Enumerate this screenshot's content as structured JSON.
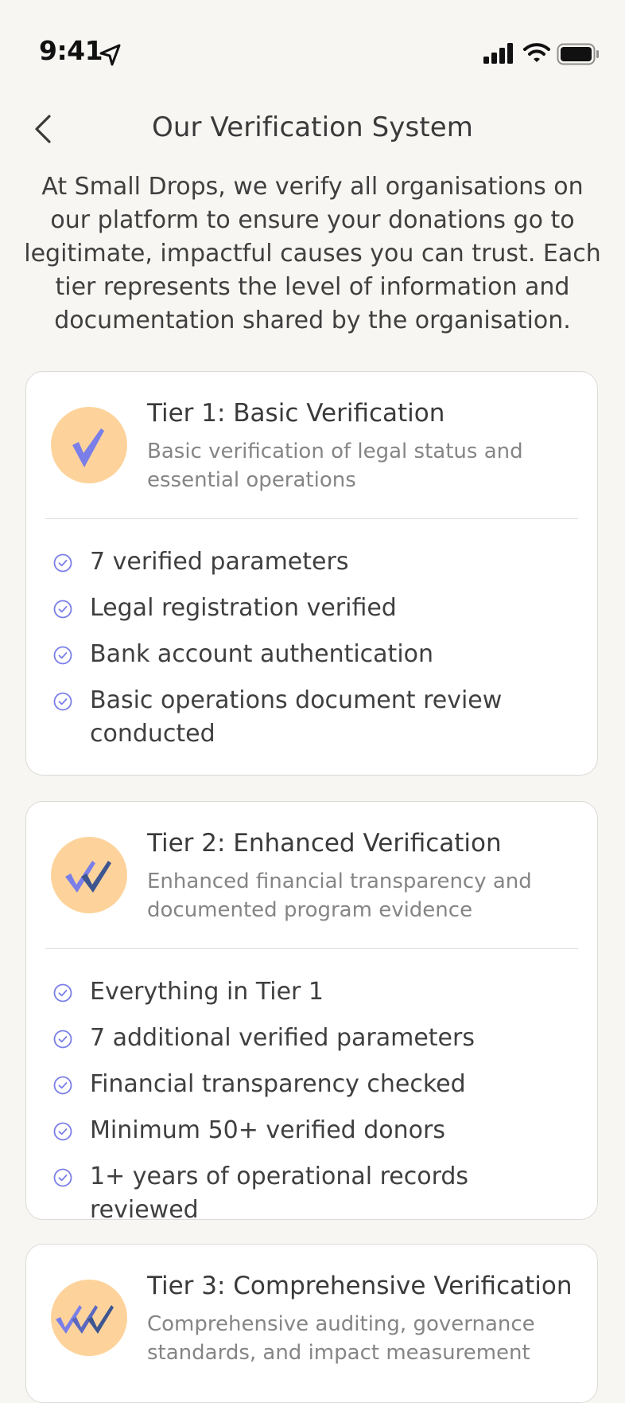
{
  "status_bar": {
    "time": "9:41",
    "icons": [
      "location-arrow-icon",
      "cellular-signal-icon",
      "wifi-icon",
      "battery-icon"
    ]
  },
  "header": {
    "back_icon": "chevron-left-icon",
    "title": "Our Verification System"
  },
  "intro": "At Small Drops, we verify all organisations on our platform to ensure your donations go to legitimate, impactful causes you can trust. Each tier represents the level of information and documentation shared by the organisation.",
  "colors": {
    "background": "#f7f6f3",
    "card": "#ffffff",
    "badge": "#fdd39b",
    "check_accent": "#7a7ee8",
    "check_dark": "#3d5590"
  },
  "tiers": [
    {
      "title": "Tier 1: Basic Verification",
      "description": "Basic verification of legal status and essential operations",
      "badge_icon": "single-check-icon",
      "features": [
        "7 verified parameters",
        "Legal registration verified",
        "Bank account authentication",
        "Basic operations document review conducted"
      ]
    },
    {
      "title": "Tier 2: Enhanced Verification",
      "description": "Enhanced financial transparency and documented program evidence",
      "badge_icon": "double-check-icon",
      "features": [
        "Everything in Tier 1",
        "7 additional verified parameters",
        "Financial transparency checked",
        "Minimum 50+ verified donors",
        "1+ years of operational records reviewed"
      ]
    },
    {
      "title": "Tier 3: Comprehensive Verification",
      "description": "Comprehensive auditing, governance standards, and impact measurement",
      "badge_icon": "triple-check-icon",
      "features": []
    }
  ]
}
